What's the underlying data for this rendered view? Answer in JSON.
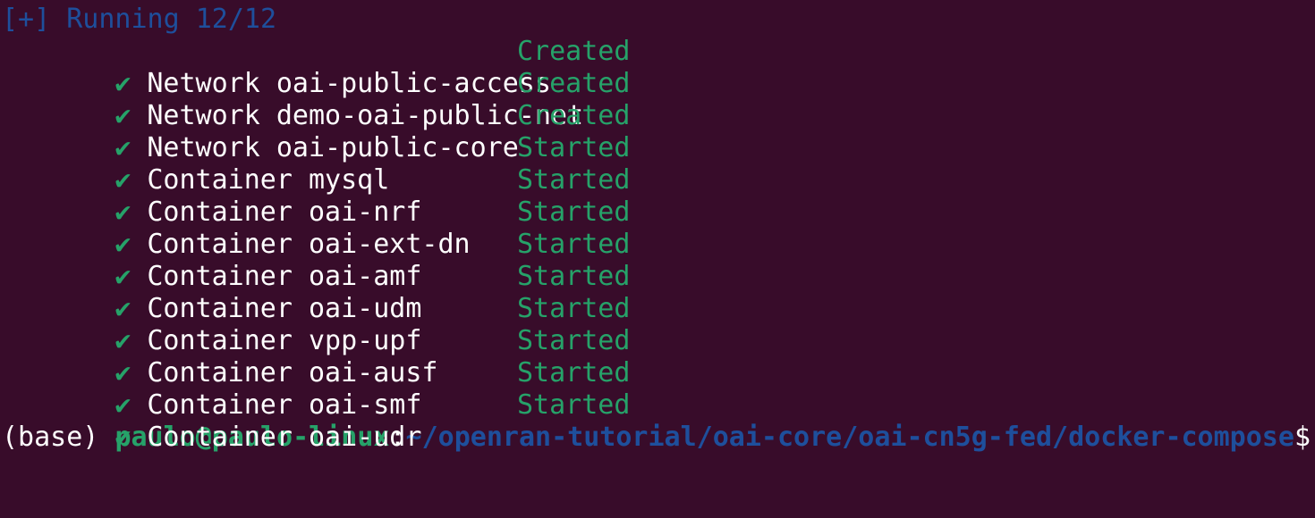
{
  "header": "[+] Running 12/12",
  "check_glyph": "✔",
  "rows": [
    {
      "kind": "Network",
      "name": "oai-public-access",
      "status": "Created"
    },
    {
      "kind": "Network",
      "name": "demo-oai-public-net",
      "status": "Created"
    },
    {
      "kind": "Network",
      "name": "oai-public-core",
      "status": "Created"
    },
    {
      "kind": "Container",
      "name": "mysql",
      "status": "Started"
    },
    {
      "kind": "Container",
      "name": "oai-nrf",
      "status": "Started"
    },
    {
      "kind": "Container",
      "name": "oai-ext-dn",
      "status": "Started"
    },
    {
      "kind": "Container",
      "name": "oai-amf",
      "status": "Started"
    },
    {
      "kind": "Container",
      "name": "oai-udm",
      "status": "Started"
    },
    {
      "kind": "Container",
      "name": "vpp-upf",
      "status": "Started"
    },
    {
      "kind": "Container",
      "name": "oai-ausf",
      "status": "Started"
    },
    {
      "kind": "Container",
      "name": "oai-smf",
      "status": "Started"
    },
    {
      "kind": "Container",
      "name": "oai-udr",
      "status": "Started"
    }
  ],
  "prompt": {
    "env": "(base) ",
    "userhost": "paulo@paulo-linux",
    "colon": ":",
    "path": "~/openran-tutorial/oai-core/oai-cn5g-fed/docker-compose",
    "dollar": "$"
  },
  "colors": {
    "background": "#380c2a",
    "header_blue": "#1e4f9c",
    "status_green": "#26a269",
    "text_white": "#ffffff"
  }
}
